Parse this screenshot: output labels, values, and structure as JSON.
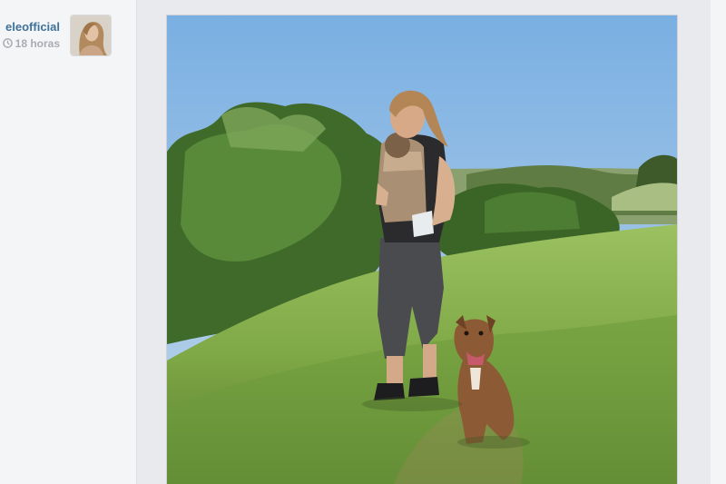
{
  "post": {
    "username": "eleofficial",
    "timestamp": "18 horas",
    "avatar_icon": "profile-photo",
    "photo_icon": "photo-woman-baby-dog-hillside"
  },
  "colors": {
    "username": "#3f729b",
    "timestamp": "#a8acb2",
    "feed_background": "#e9eaed"
  }
}
